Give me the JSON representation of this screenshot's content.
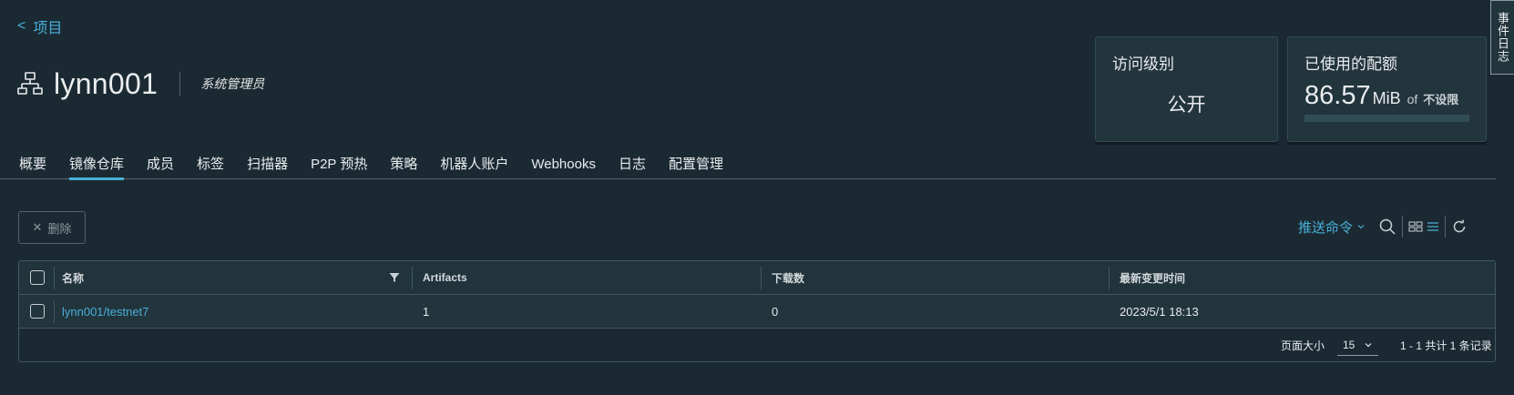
{
  "nav": {
    "back_chevron": "<",
    "back_label": "项目"
  },
  "project": {
    "name": "lynn001",
    "role": "系统管理员",
    "icon": "project-icon"
  },
  "access_card": {
    "title": "访问级别",
    "value": "公开"
  },
  "quota_card": {
    "title": "已使用的配额",
    "used": "86.57",
    "unit": "MiB",
    "of": "of",
    "limit": "不设限",
    "fill_fraction": 0
  },
  "side_tab": {
    "label": "事件日志"
  },
  "tabs": [
    {
      "label": "概要",
      "active": false
    },
    {
      "label": "镜像仓库",
      "active": true
    },
    {
      "label": "成员",
      "active": false
    },
    {
      "label": "标签",
      "active": false
    },
    {
      "label": "扫描器",
      "active": false
    },
    {
      "label": "P2P 预热",
      "active": false
    },
    {
      "label": "策略",
      "active": false
    },
    {
      "label": "机器人账户",
      "active": false
    },
    {
      "label": "Webhooks",
      "active": false
    },
    {
      "label": "日志",
      "active": false
    },
    {
      "label": "配置管理",
      "active": false
    }
  ],
  "toolbar": {
    "delete_label": "删除",
    "push_command_label": "推送命令"
  },
  "table": {
    "headers": {
      "name": "名称",
      "artifacts": "Artifacts",
      "downloads": "下载数",
      "updated": "最新变更时间"
    },
    "rows": [
      {
        "name": "lynn001/testnet7",
        "artifacts": "1",
        "downloads": "0",
        "updated": "2023/5/1 18:13"
      }
    ],
    "footer": {
      "page_size_label": "页面大小",
      "page_size": "15",
      "summary": "1 - 1 共计 1 条记录"
    }
  },
  "colors": {
    "accent": "#49afd9",
    "background": "#1b2a32",
    "card": "#22343c"
  }
}
